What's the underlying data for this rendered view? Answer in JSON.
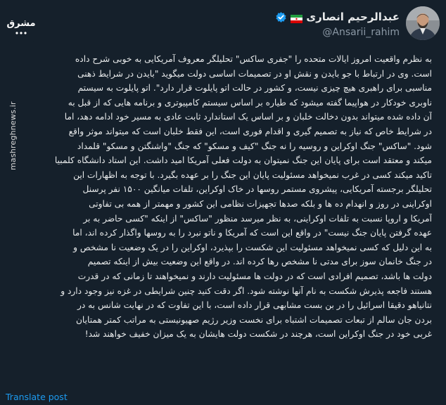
{
  "author": {
    "name": "عبدالرحیم انصاری",
    "handle": "@Ansarii_rahim",
    "flag_icon": "iran-flag-icon",
    "verified_icon": "verified-badge-icon",
    "verified_color": "#1d9bf0"
  },
  "watermark": {
    "logo_text": "مشرق",
    "site": "mashreghnews.ir"
  },
  "tweet_lines": [
    "به نظرم واقعیت امروز ایالات متحده را \"جفری ساکس\" تحلیلگر معروف آمریکایی به خوبی شرح داده",
    "است. وی در ارتباط با جو بایدن و نقش او در تصمیمات اساسی دولت میگوید \"بایدن در شرایط ذهنی",
    "مناسبی برای راهبری هیچ چیزی نیست، و کشور در حالت اتو پایلوت قرار دارد\". اتو پایلوت به سیستم",
    "ناوبری خودکار در هواپیما گفته میشود که طیاره بر اساس سیستم کامپیوتری و برنامه هایی که از قبل به",
    "آن داده شده میتواند بدون دخالت خلبان و بر اساس یک استاندارد ثابت عادی به مسیر خود ادامه دهد، اما",
    "در شرایط خاص که نیاز به تصمیم گیری و اقدام فوری است، این فقط خلبان است که میتواند موثر واقع",
    "شود. \"ساکس\" جنگ اوکراین و روسیه را نه جنگ \"کیف و مسکو\" که جنگ \"واشنگتن و مسکو\" قلمداد",
    "میکند و معتقد است برای پایان این جنگ نمیتوان به دولت فعلی آمریکا امید داشت. این استاد دانشگاه کلمبیا",
    "تاکید میکند کسی در غرب نمیخواهد مسئولیت پایان این جنگ را بر عهده بگیرد. با توجه به اظهارات این",
    "تحلیلگر برجسته آمریکایی، پیشروی مستمر روسها در خاک اوکراین، تلفات میانگین ۱۵۰۰ نفر پرسنل",
    "اوکراینی در روز و انهدام ده ها و بلکه صدها تجهیزات نظامی این کشور و مهمتر از همه بی تفاوتی",
    "آمریکا و اروپا نسبت به تلفات اوکراینی، به نظر میرسد منظور \"ساکس\" از اینکه \"کسی حاضر به بر",
    "عهده گرفتن پایان جنگ نیست\" در واقع این است که آمریکا و ناتو نبرد را به روسها واگذار کرده اند، اما",
    "به این دلیل که کسی نمیخواهد مسئولیت این شکست را بپذیرد، اوکراین را در یک وضعیت نا مشخص و",
    "در جنگ خانمان سوز برای مدتی نا مشخص رها کرده اند. در واقع این وضعیت بیش از اینکه تصمیم",
    "دولت ها باشد، تصمیم افرادی است که در دولت ها مسئولیت دارند و نمیخواهند تا زمانی که در قدرت",
    "هستند فاجعه پذیرش شکست به نام آنها نوشته شود. اگر دقت کنید چنین شرایطی در غزه نیز وجود دارد و",
    "نتانیاهو دقیقا اسرائیل را در بن بست مشابهی قرار داده است، با این تفاوت که در نهایت شانس به در",
    "بردن جان سالم از تبعات تصمیمات اشتباه برای نخست وزیر رژیم صهیونیستی به مراتب کمتر همتایان",
    "غربی خود در جنگ اوکراین است، هرچند در شکست دولت هایشان به یک میزان خفیف خواهند شد!"
  ],
  "translate_label": "Translate post"
}
